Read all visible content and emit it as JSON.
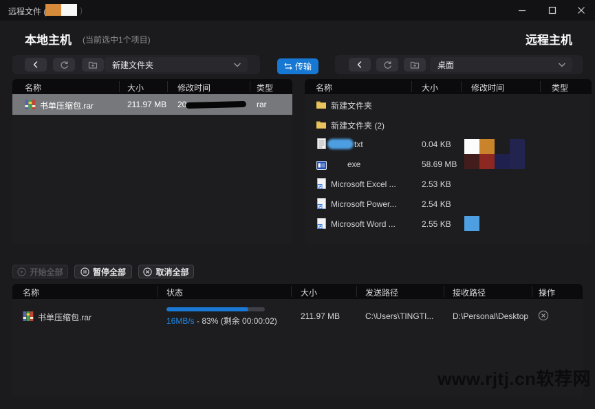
{
  "titlebar": {
    "title": "远程文件 (",
    "title_close": ")"
  },
  "header": {
    "local_title": "本地主机",
    "local_subtitle": "(当前选中1个项目)",
    "remote_title": "远程主机"
  },
  "transfer": {
    "label": "传输"
  },
  "left_panel": {
    "path": "新建文件夹",
    "columns": [
      "名称",
      "大小",
      "修改时间",
      "类型"
    ],
    "rows": [
      {
        "name": "书单压缩包.rar",
        "size": "211.97 MB",
        "time_visible": "20",
        "type": "rar"
      }
    ]
  },
  "right_panel": {
    "path": "桌面",
    "columns": [
      "名称",
      "大小",
      "修改时间",
      "类型"
    ],
    "rows": [
      {
        "name": "新建文件夹",
        "size": ""
      },
      {
        "name": "新建文件夹 (2)",
        "size": ""
      },
      {
        "name": "txt",
        "size": "0.04 KB"
      },
      {
        "name": "exe",
        "size": "58.69 MB"
      },
      {
        "name": "Microsoft Excel ...",
        "size": "2.53 KB"
      },
      {
        "name": "Microsoft Power...",
        "size": "2.54 KB"
      },
      {
        "name": "Microsoft Word ...",
        "size": "2.55 KB"
      }
    ]
  },
  "queue": {
    "start_label": "开始全部",
    "pause_label": "暂停全部",
    "cancel_label": "取消全部",
    "columns": [
      "名称",
      "状态",
      "大小",
      "发送路径",
      "接收路径",
      "操作"
    ],
    "rows": [
      {
        "name": "书单压缩包.rar",
        "speed": "16MB/s",
        "status_rest": " - 83% (剩余 00:00:02)",
        "progress_pct": 83,
        "size": "211.97 MB",
        "send_path": "C:\\Users\\TINGTI...",
        "recv_path": "D:\\Personal\\Desktop"
      }
    ]
  },
  "watermark": "www.rjtj.cn软荐网",
  "colors": {
    "accent": "#1778d3",
    "speed_text": "#1e88e5",
    "selected_row": "#77787c"
  },
  "icons": {
    "back": "chevron-left",
    "refresh": "circular-arrow",
    "new_folder": "folder-plus",
    "dropdown": "chevron-down",
    "transfer": "sync-arrows",
    "minimize": "line",
    "maximize": "square",
    "close": "x",
    "start": "play-circle",
    "pause": "pause-circle",
    "cancel": "x-circle",
    "remove": "x-circle"
  }
}
